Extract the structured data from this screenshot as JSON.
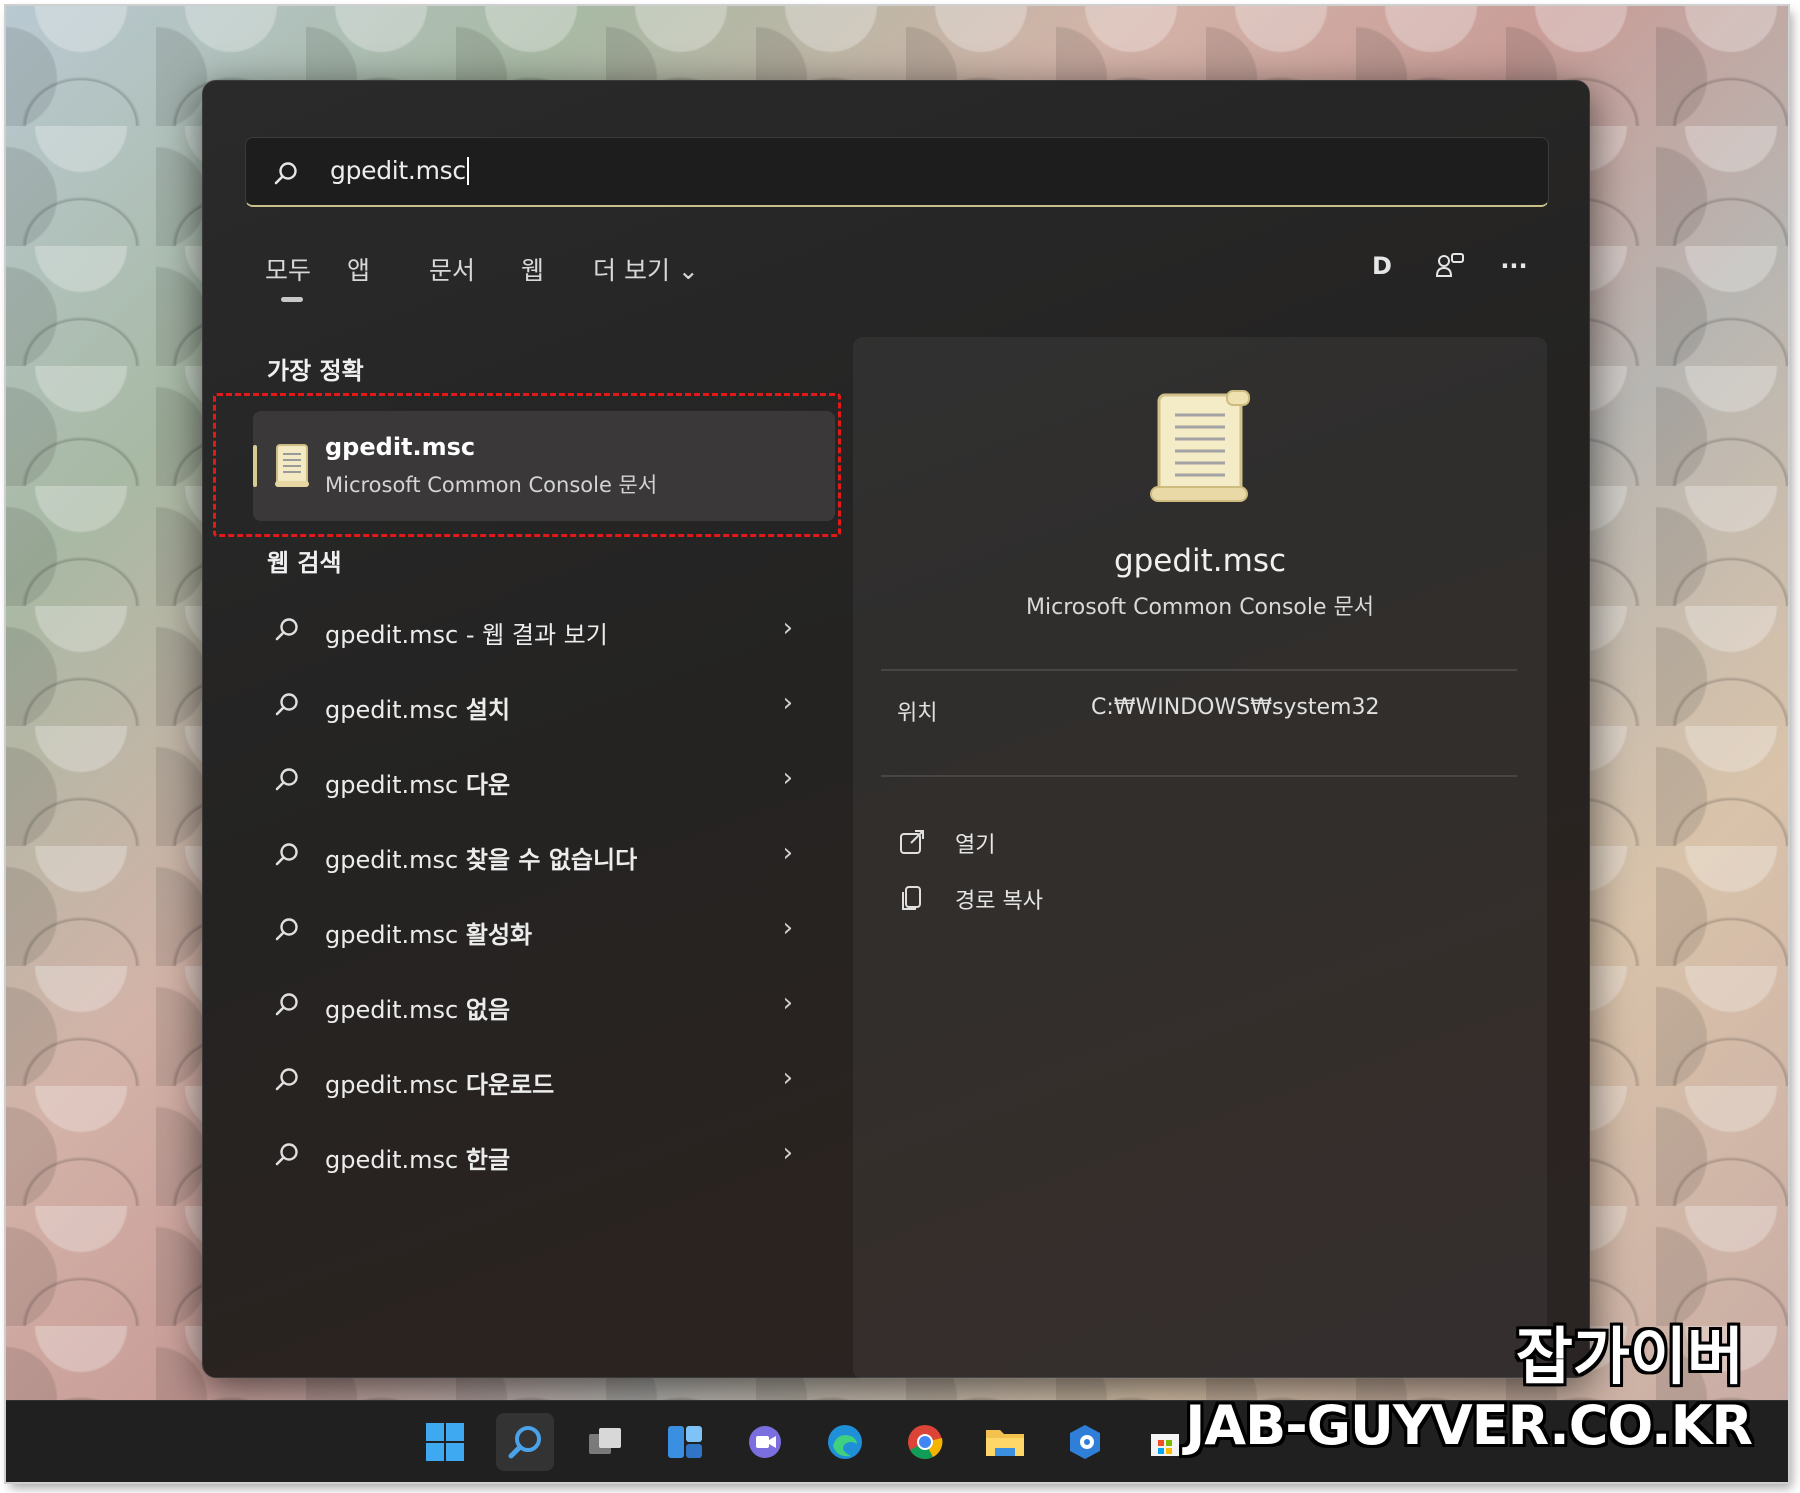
{
  "search": {
    "value": "gpedit.msc"
  },
  "tabs": [
    {
      "label": "모두"
    },
    {
      "label": "앱"
    },
    {
      "label": "문서"
    },
    {
      "label": "웹"
    },
    {
      "label": "더 보기 ⌄"
    }
  ],
  "account": {
    "initial": "D"
  },
  "more_label": "···",
  "best_match": {
    "heading": "가장 정확",
    "name": "gpedit.msc",
    "subtitle": "Microsoft Common Console 문서"
  },
  "web_search": {
    "heading": "웹 검색",
    "items": [
      {
        "prefix": "gpedit.msc - ",
        "suffix": "웹 결과 보기",
        "bold": false
      },
      {
        "prefix": "gpedit.msc ",
        "suffix": "설치",
        "bold": true
      },
      {
        "prefix": "gpedit.msc ",
        "suffix": "다운",
        "bold": true
      },
      {
        "prefix": "gpedit.msc ",
        "suffix": "찾을 수 없습니다",
        "bold": true
      },
      {
        "prefix": "gpedit.msc ",
        "suffix": "활성화",
        "bold": true
      },
      {
        "prefix": "gpedit.msc ",
        "suffix": "없음",
        "bold": true
      },
      {
        "prefix": "gpedit.msc ",
        "suffix": "다운로드",
        "bold": true
      },
      {
        "prefix": "gpedit.msc ",
        "suffix": "한글",
        "bold": true
      }
    ]
  },
  "detail": {
    "name": "gpedit.msc",
    "subtitle": "Microsoft Common Console 문서",
    "location_label": "위치",
    "location_value": "C:₩WINDOWS₩system32",
    "actions": [
      {
        "label": "열기",
        "icon": "open-external-icon"
      },
      {
        "label": "경로 복사",
        "icon": "copy-icon"
      }
    ]
  },
  "taskbar": {
    "icons": [
      "windows-start-icon",
      "search-icon",
      "task-view-icon",
      "widgets-icon",
      "chat-icon",
      "edge-icon",
      "chrome-icon",
      "file-explorer-icon",
      "settings-app-icon",
      "store-icon"
    ]
  },
  "watermark": {
    "korean": "잡가이버",
    "site": "JAB-GUYVER.CO.KR"
  }
}
